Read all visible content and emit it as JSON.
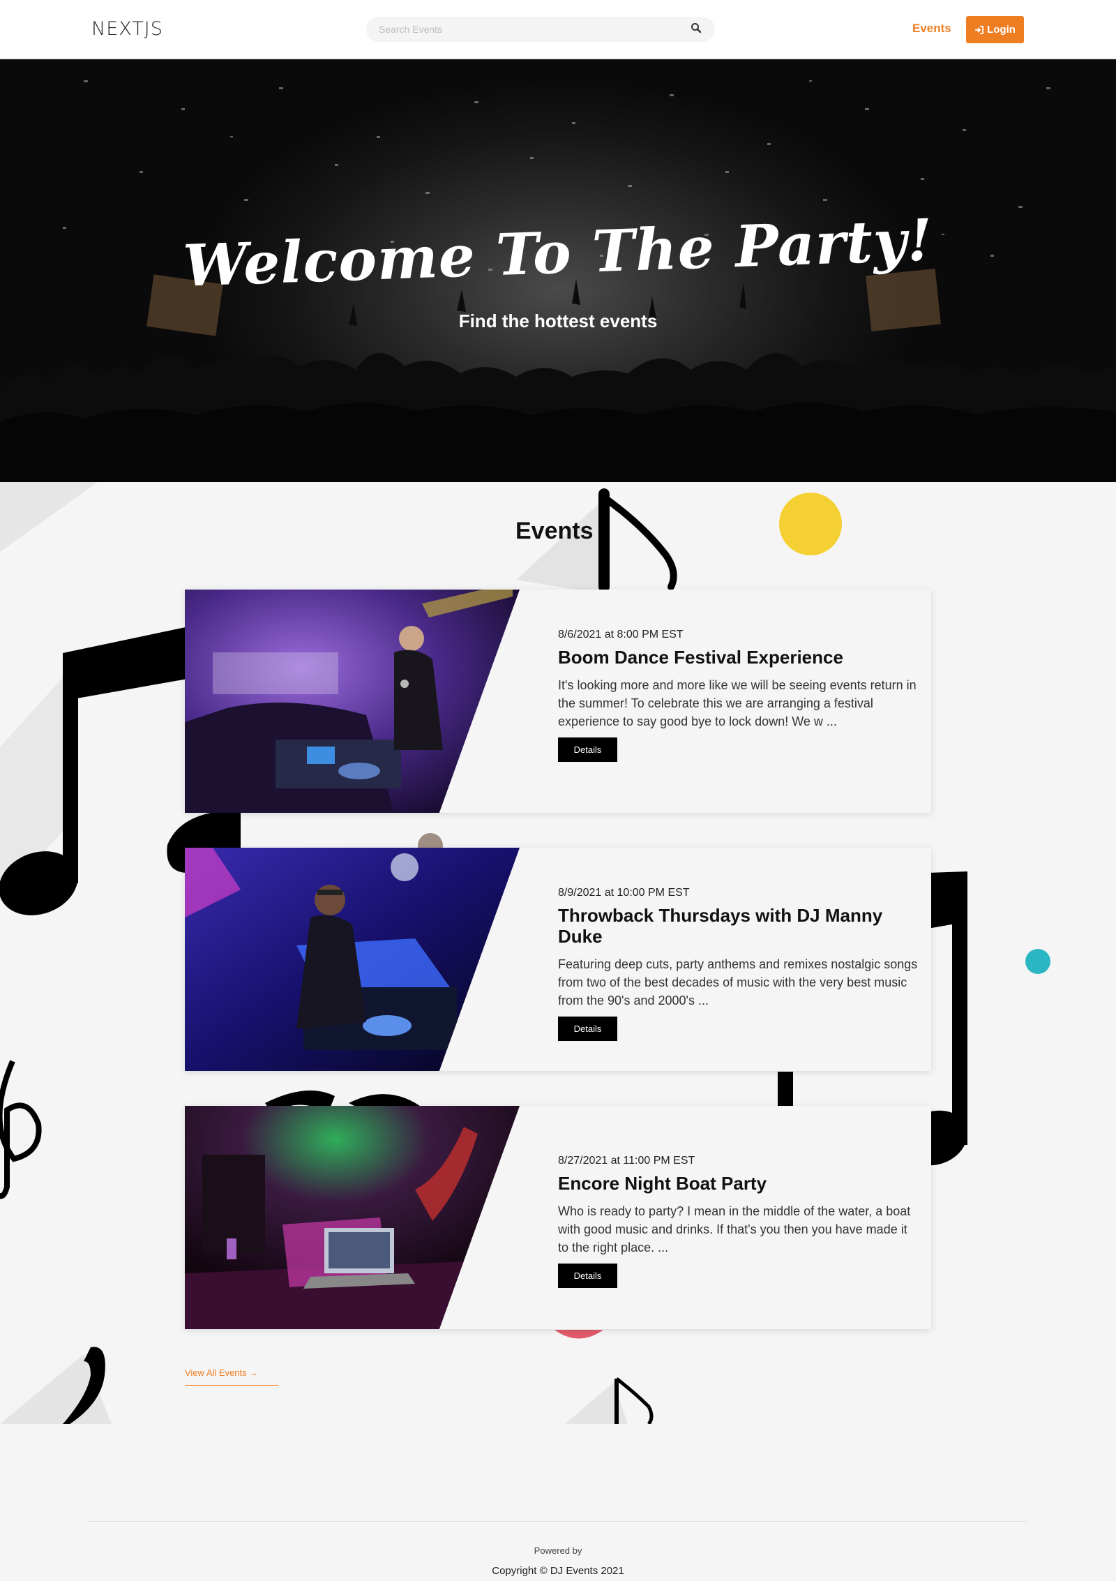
{
  "header": {
    "logo": "NEXTJS",
    "search_placeholder": "Search Events",
    "nav_events": "Events",
    "login_label": "Login"
  },
  "hero": {
    "title": "Welcome To The Party!",
    "subtitle": "Find the hottest events"
  },
  "events_section": {
    "title": "Events",
    "events": [
      {
        "date": "8/6/2021 at 8:00 PM EST",
        "title": "Boom Dance Festival Experience",
        "description": "It's looking more and more like we will be seeing events return in the summer! To celebrate this we are arranging a festival experience to say good bye to lock down! We w ...",
        "details_label": "Details"
      },
      {
        "date": "8/9/2021 at 10:00 PM EST",
        "title": "Throwback Thursdays with DJ Manny Duke",
        "description": "Featuring deep cuts, party anthems and remixes nostalgic songs from two of the best decades of music with the very best music from the 90's and 2000's ...",
        "details_label": "Details"
      },
      {
        "date": "8/27/2021 at 11:00 PM EST",
        "title": "Encore Night Boat Party",
        "description": "Who is ready to party? I mean in the middle of the water, a boat with good music and drinks. If that's you then you have made it to the right place. ...",
        "details_label": "Details"
      }
    ],
    "view_all": "View All Events →"
  },
  "footer": {
    "powered_by": "Powered by",
    "copyright": "Copyright © DJ Events 2021"
  },
  "colors": {
    "accent": "#ef7e23",
    "dark": "#000000",
    "background": "#f5f5f5"
  }
}
